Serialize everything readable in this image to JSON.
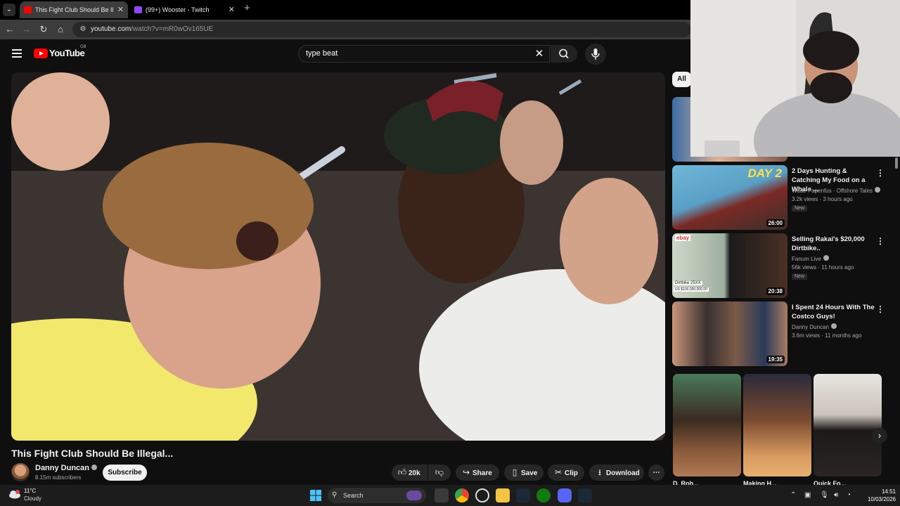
{
  "browser": {
    "tabs": [
      {
        "label": "This Fight Club Should Be Illegal...",
        "active": true
      },
      {
        "label": "(99+) Wooster - Twitch",
        "active": false
      }
    ],
    "url_host": "youtube.com",
    "url_path": "/watch?v=mR0wOv165UE"
  },
  "youtube": {
    "logo_text": "YouTube",
    "country_code": "GB",
    "search_query": "type beat",
    "video": {
      "title": "This Fight Club Should Be Illegal...",
      "channel": "Danny Duncan",
      "subscribers": "8.15m subscribers",
      "subscribe_label": "Subscribe",
      "likes": "20k",
      "share_label": "Share",
      "save_label": "Save",
      "clip_label": "Clip",
      "download_label": "Download"
    },
    "filter_chip": "All",
    "recommendations": [
      {
        "title": "2 Days Hunting & Catching My Food on a Whale ...",
        "channel": "Wade Papenfus · Offshore Tales",
        "meta": "3.2k views · 3 hours ago",
        "badge": "New",
        "duration": "26:00"
      },
      {
        "title": "Selling Rakai's $20,000 Dirtbike..",
        "channel": "Fanum Live",
        "meta": "56k views · 11 hours ago",
        "badge": "New",
        "duration": "20:38"
      },
      {
        "title": "I Spent 24 Hours With The Costco Guys!",
        "channel": "Danny Duncan",
        "meta": "3.6m views · 11 months ago",
        "badge": "",
        "duration": "19:35"
      }
    ],
    "shorts_labels": [
      "D. Rob...",
      "Making H...",
      "Quick Fo..."
    ],
    "thumb_texts": {
      "day2": "DAY 2",
      "ebay": "ebay",
      "dirtbike": "Dirtbike 25XX",
      "price": "US $100,000,000.00"
    }
  },
  "taskbar": {
    "weather_temp": "11°C",
    "weather_cond": "Cloudy",
    "search_label": "Search",
    "time": "14:51",
    "date": "10/03/2026"
  },
  "colors": {
    "youtube_red": "#ff0000",
    "background": "#0f0f0f",
    "chip": "#272727"
  }
}
